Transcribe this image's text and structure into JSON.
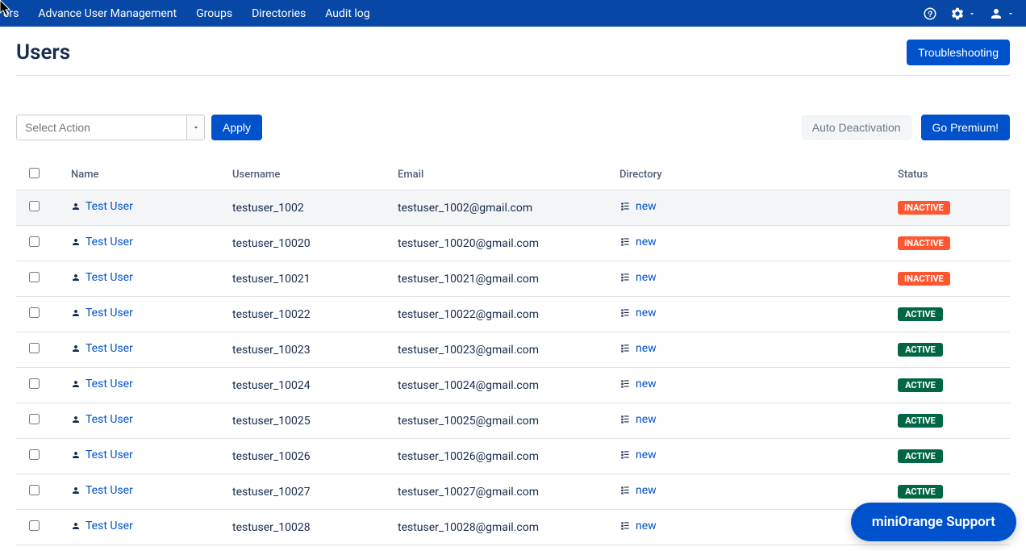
{
  "nav": {
    "items": [
      "ers",
      "Advance User Management",
      "Groups",
      "Directories",
      "Audit log"
    ]
  },
  "header": {
    "title": "Users",
    "troubleshooting": "Troubleshooting"
  },
  "toolbar": {
    "select_placeholder": "Select Action",
    "apply": "Apply",
    "auto_deactivation": "Auto Deactivation",
    "go_premium": "Go Premium!"
  },
  "table": {
    "headers": {
      "name": "Name",
      "username": "Username",
      "email": "Email",
      "directory": "Directory",
      "status": "Status"
    },
    "rows": [
      {
        "name": "Test User",
        "username": "testuser_1002",
        "email": "testuser_1002@gmail.com",
        "directory": "new",
        "status": "INACTIVE",
        "status_class": "badge-inactive"
      },
      {
        "name": "Test User",
        "username": "testuser_10020",
        "email": "testuser_10020@gmail.com",
        "directory": "new",
        "status": "INACTIVE",
        "status_class": "badge-inactive"
      },
      {
        "name": "Test User",
        "username": "testuser_10021",
        "email": "testuser_10021@gmail.com",
        "directory": "new",
        "status": "INACTIVE",
        "status_class": "badge-inactive"
      },
      {
        "name": "Test User",
        "username": "testuser_10022",
        "email": "testuser_10022@gmail.com",
        "directory": "new",
        "status": "ACTIVE",
        "status_class": "badge-active"
      },
      {
        "name": "Test User",
        "username": "testuser_10023",
        "email": "testuser_10023@gmail.com",
        "directory": "new",
        "status": "ACTIVE",
        "status_class": "badge-active"
      },
      {
        "name": "Test User",
        "username": "testuser_10024",
        "email": "testuser_10024@gmail.com",
        "directory": "new",
        "status": "ACTIVE",
        "status_class": "badge-active"
      },
      {
        "name": "Test User",
        "username": "testuser_10025",
        "email": "testuser_10025@gmail.com",
        "directory": "new",
        "status": "ACTIVE",
        "status_class": "badge-active"
      },
      {
        "name": "Test User",
        "username": "testuser_10026",
        "email": "testuser_10026@gmail.com",
        "directory": "new",
        "status": "ACTIVE",
        "status_class": "badge-active"
      },
      {
        "name": "Test User",
        "username": "testuser_10027",
        "email": "testuser_10027@gmail.com",
        "directory": "new",
        "status": "ACTIVE",
        "status_class": "badge-active"
      },
      {
        "name": "Test User",
        "username": "testuser_10028",
        "email": "testuser_10028@gmail.com",
        "directory": "new",
        "status": "",
        "status_class": ""
      }
    ]
  },
  "support": {
    "label": "miniOrange Support"
  }
}
